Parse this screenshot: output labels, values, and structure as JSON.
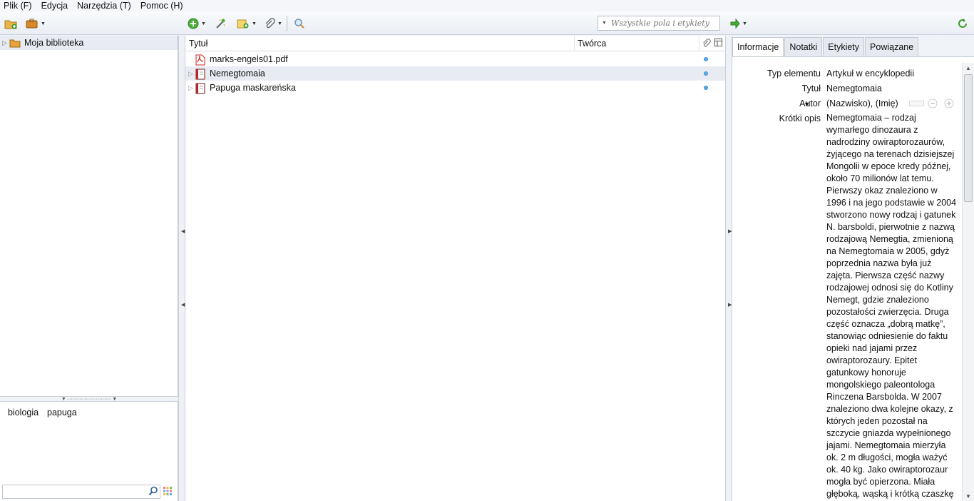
{
  "menu": [
    {
      "label": "Plik (F)"
    },
    {
      "label": "Edycja"
    },
    {
      "label": "Narzędzia (T)"
    },
    {
      "label": "Pomoc (H)"
    }
  ],
  "toolbar": {
    "search_placeholder": "Wszystkie pola i etykiety"
  },
  "collections": {
    "root_label": "Moja biblioteka"
  },
  "tags": [
    "biologia",
    "papuga"
  ],
  "items_pane": {
    "columns": {
      "title": "Tytuł",
      "creator": "Twórca"
    },
    "rows": [
      {
        "title": "marks-engels01.pdf",
        "type": "pdf"
      },
      {
        "title": "Nemegtomaia",
        "type": "book",
        "selected": true
      },
      {
        "title": "Papuga maskareńska",
        "type": "book"
      }
    ]
  },
  "item_pane": {
    "tabs": [
      "Informacje",
      "Notatki",
      "Etykiety",
      "Powiązane"
    ],
    "active_tab": "Informacje",
    "fields": {
      "item_type_label": "Typ elementu",
      "item_type_value": "Artykuł w encyklopedii",
      "title_label": "Tytuł",
      "title_value": "Nemegtomaia",
      "author_label": "Autor",
      "author_value": "(Nazwisko), (Imię)",
      "abstract_label": "Krótki opis",
      "abstract_value": "Nemegtomaia – rodzaj wymarłego dinozaura z nadrodziny owiraptorozaurów, żyjącego na terenach dzisiejszej Mongolii w epoce kredy późnej, około 70 milionów lat temu. Pierwszy okaz znaleziono w 1996 i na jego podstawie w 2004 stworzono nowy rodzaj i gatunek N. barsboldi, pierwotnie z nazwą rodzajową Nemegtia, zmienioną na Nemegtomaia w 2005, gdyż poprzednia nazwa była już zajęta. Pierwsza część nazwy rodzajowej odnosi się do Kotliny Nemegt, gdzie znaleziono pozostałości zwierzęcia. Druga część oznacza „dobrą matkę”, stanowiąc odniesienie do faktu opieki nad jajami przez owiraptorozaury. Epitet gatunkowy honoruje mongolskiego paleontologa Rinczena Barsbolda. W 2007 znaleziono dwa kolejne okazy, z których jeden pozostał na szczycie gniazda wypełnionego jajami. Nemegtomaia mierzyła ok. 2 m długości, mogła ważyć ok. 40 kg. Jako owiraptorozaur mogła być opierzona. Miała głęboką, wąską i krótką czaszkę z łukowatym grzebieniem. Była bezzębna z"
    }
  },
  "colors": {
    "accent_green": "#3a9a2a",
    "folder_orange": "#e8a43a",
    "pdf_red": "#c8251b",
    "unread_dot": "#5aa9e6"
  }
}
